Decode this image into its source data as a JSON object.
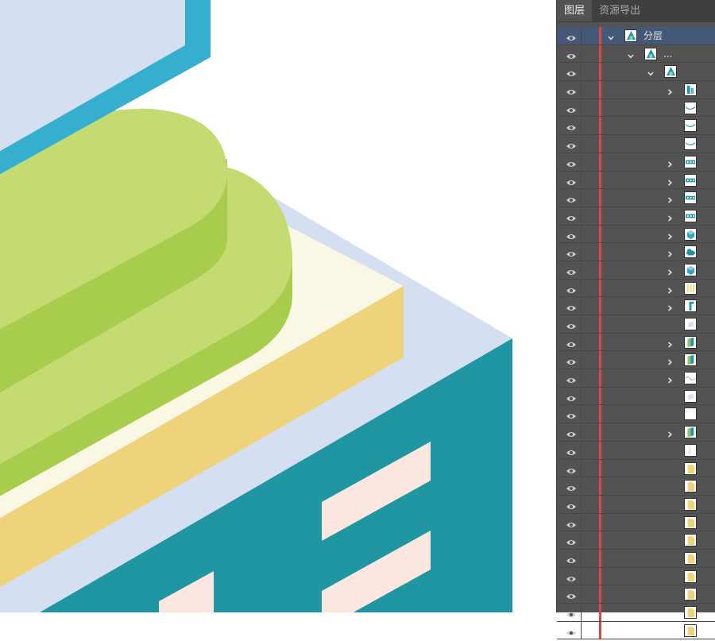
{
  "panel": {
    "tabs": [
      {
        "label": "图层",
        "active": true
      },
      {
        "label": "资源导出",
        "active": false
      }
    ]
  },
  "colors": {
    "panel_bg": "#535353",
    "tab_bar_bg": "#3f3f3f",
    "selection": "#465878",
    "layer_color_bar": "#e04646",
    "teal_wall": "#2196a3",
    "roof_top": "#d4dff1",
    "cream_top": "#faf7e5",
    "cream_side": "#efd37b",
    "green_top": "#c4db72",
    "green_side": "#a8cd4c",
    "window": "#fbe7df",
    "blue_frame": "#35aed0"
  },
  "layers": [
    {
      "level": 0,
      "expandable": true,
      "expanded": true,
      "name": "分层",
      "thumb": "building",
      "selected": true
    },
    {
      "level": 1,
      "expandable": true,
      "expanded": true,
      "name": "...",
      "thumb": "building",
      "selected": false
    },
    {
      "level": 2,
      "expandable": true,
      "expanded": true,
      "name": "",
      "thumb": "building",
      "selected": false
    },
    {
      "level": 3,
      "expandable": true,
      "expanded": false,
      "name": "",
      "thumb": "tower",
      "selected": false
    },
    {
      "level": 3,
      "expandable": false,
      "expanded": false,
      "name": "",
      "thumb": "curve",
      "selected": false
    },
    {
      "level": 3,
      "expandable": false,
      "expanded": false,
      "name": "",
      "thumb": "curve",
      "selected": false
    },
    {
      "level": 3,
      "expandable": false,
      "expanded": false,
      "name": "",
      "thumb": "curve",
      "selected": false
    },
    {
      "level": 3,
      "expandable": true,
      "expanded": false,
      "name": "",
      "thumb": "strip",
      "selected": false
    },
    {
      "level": 3,
      "expandable": true,
      "expanded": false,
      "name": "",
      "thumb": "strip",
      "selected": false
    },
    {
      "level": 3,
      "expandable": true,
      "expanded": false,
      "name": "",
      "thumb": "strip",
      "selected": false
    },
    {
      "level": 3,
      "expandable": true,
      "expanded": false,
      "name": "",
      "thumb": "strip",
      "selected": false
    },
    {
      "level": 3,
      "expandable": true,
      "expanded": false,
      "name": "",
      "thumb": "cube",
      "selected": false
    },
    {
      "level": 3,
      "expandable": true,
      "expanded": false,
      "name": "",
      "thumb": "cloud",
      "selected": false
    },
    {
      "level": 3,
      "expandable": true,
      "expanded": false,
      "name": "",
      "thumb": "cube",
      "selected": false
    },
    {
      "level": 3,
      "expandable": true,
      "expanded": false,
      "name": "",
      "thumb": "bars",
      "selected": false
    },
    {
      "level": 3,
      "expandable": true,
      "expanded": false,
      "name": "",
      "thumb": "pole",
      "selected": false
    },
    {
      "level": 3,
      "expandable": false,
      "expanded": false,
      "name": "",
      "thumb": "faint",
      "selected": false
    },
    {
      "level": 3,
      "expandable": true,
      "expanded": false,
      "name": "",
      "thumb": "panel",
      "selected": false
    },
    {
      "level": 3,
      "expandable": true,
      "expanded": false,
      "name": "",
      "thumb": "panel",
      "selected": false
    },
    {
      "level": 3,
      "expandable": true,
      "expanded": false,
      "name": "",
      "thumb": "wave",
      "selected": false
    },
    {
      "level": 3,
      "expandable": false,
      "expanded": false,
      "name": "",
      "thumb": "faint",
      "selected": false
    },
    {
      "level": 3,
      "expandable": false,
      "expanded": false,
      "name": "",
      "thumb": "blank",
      "selected": false
    },
    {
      "level": 3,
      "expandable": true,
      "expanded": false,
      "name": "",
      "thumb": "panel",
      "selected": false
    },
    {
      "level": 3,
      "expandable": false,
      "expanded": false,
      "name": "",
      "thumb": "line",
      "selected": false
    },
    {
      "level": 3,
      "expandable": false,
      "expanded": false,
      "name": "",
      "thumb": "doc",
      "selected": false
    },
    {
      "level": 3,
      "expandable": false,
      "expanded": false,
      "name": "",
      "thumb": "doc",
      "selected": false
    },
    {
      "level": 3,
      "expandable": false,
      "expanded": false,
      "name": "",
      "thumb": "doc",
      "selected": false
    },
    {
      "level": 3,
      "expandable": false,
      "expanded": false,
      "name": "",
      "thumb": "doc",
      "selected": false
    },
    {
      "level": 3,
      "expandable": false,
      "expanded": false,
      "name": "",
      "thumb": "doc",
      "selected": false
    },
    {
      "level": 3,
      "expandable": false,
      "expanded": false,
      "name": "",
      "thumb": "doc",
      "selected": false
    },
    {
      "level": 3,
      "expandable": false,
      "expanded": false,
      "name": "",
      "thumb": "doc",
      "selected": false
    },
    {
      "level": 3,
      "expandable": false,
      "expanded": false,
      "name": "",
      "thumb": "doc",
      "selected": false
    },
    {
      "level": 3,
      "expandable": false,
      "expanded": false,
      "name": "",
      "thumb": "doc",
      "selected": false
    },
    {
      "level": 3,
      "expandable": false,
      "expanded": false,
      "name": "",
      "thumb": "doc",
      "selected": false
    }
  ]
}
